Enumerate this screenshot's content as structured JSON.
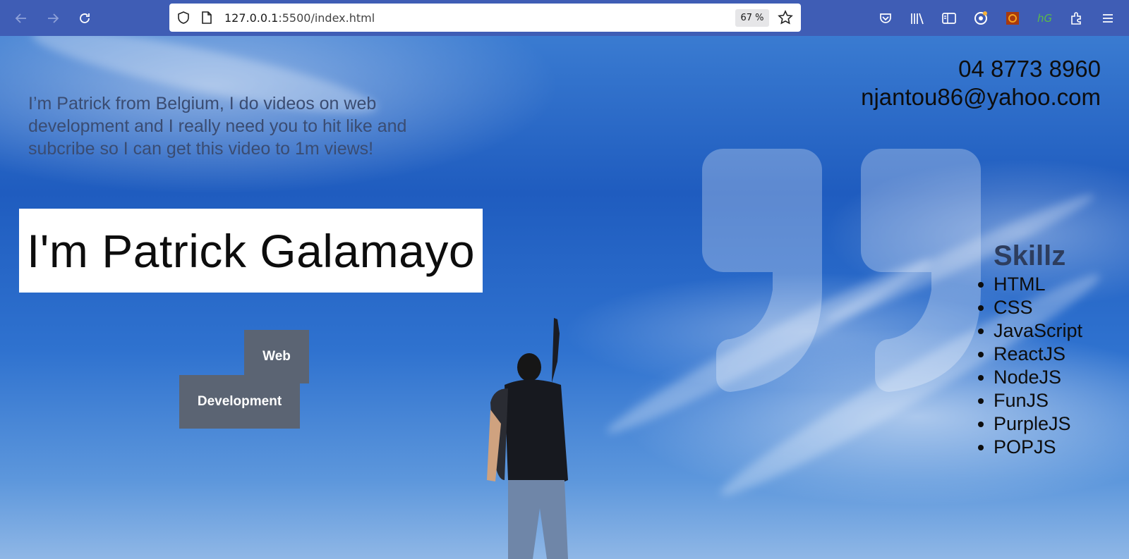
{
  "browser": {
    "url_host": "127.0.0.1",
    "url_path": ":5500/index.html",
    "zoom": "67 %"
  },
  "page": {
    "intro": "I’m Patrick from Belgium, I do videos on web development and I really need you to hit like and subcribe so I can get this video to 1m views!",
    "contact": {
      "phone": "04 8773 8960",
      "email": "njantou86@yahoo.com"
    },
    "name": "I'm Patrick Galamayo",
    "tags": {
      "web": "Web",
      "development": "Development"
    },
    "skills": {
      "title": "Skillz",
      "items": [
        "HTML",
        "CSS",
        "JavaScript",
        "ReactJS",
        "NodeJS",
        "FunJS",
        "PurpleJS",
        "POPJS"
      ]
    }
  },
  "icons": [
    "back-icon",
    "forward-icon",
    "reload-icon",
    "shield-icon",
    "page-icon",
    "bookmark-star-icon",
    "pocket-icon",
    "library-icon",
    "sidebar-icon",
    "account-icon",
    "extension-orange-icon",
    "extension-green-icon",
    "extensions-icon",
    "menu-icon"
  ]
}
